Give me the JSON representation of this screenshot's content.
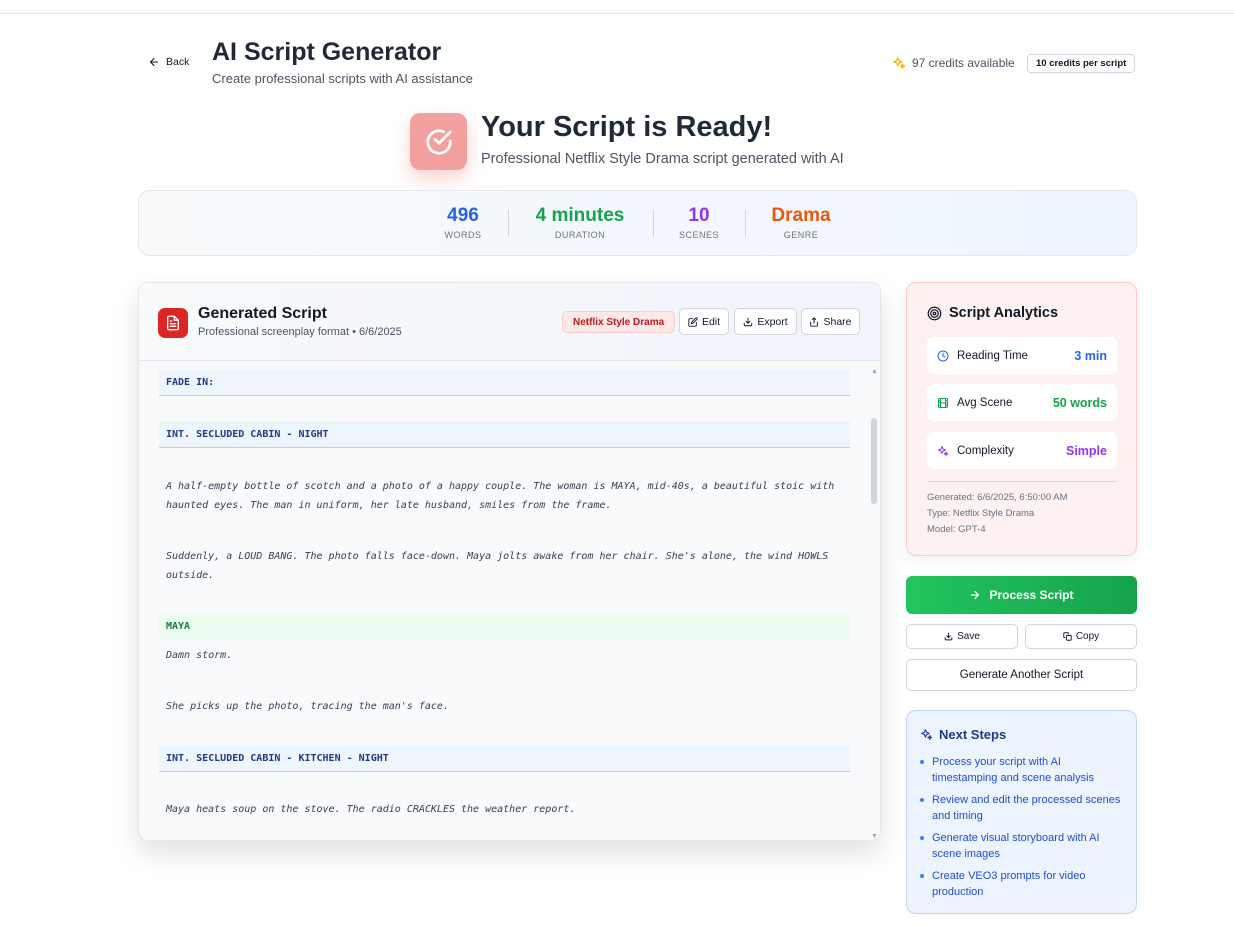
{
  "header": {
    "back_label": "Back",
    "title": "AI Script Generator",
    "subtitle": "Create professional scripts with AI assistance",
    "credits_text": "97 credits available",
    "credit_cost_badge": "10 credits per script"
  },
  "hero": {
    "title": "Your Script is Ready!",
    "subtitle": "Professional Netflix Style Drama script generated with AI"
  },
  "stats": [
    {
      "value": "496",
      "label": "WORDS",
      "color": "#2563eb"
    },
    {
      "value": "4 minutes",
      "label": "DURATION",
      "color": "#16a34a"
    },
    {
      "value": "10",
      "label": "SCENES",
      "color": "#9333ea"
    },
    {
      "value": "Drama",
      "label": "GENRE",
      "color": "#ea580c"
    }
  ],
  "script": {
    "title": "Generated Script",
    "subtitle": "Professional screenplay format • 6/6/2025",
    "genre_badge": "Netflix Style Drama",
    "edit_label": "Edit",
    "export_label": "Export",
    "share_label": "Share",
    "lines": [
      {
        "type": "heading",
        "text": "FADE IN:"
      },
      {
        "type": "heading",
        "text": "INT. SECLUDED CABIN - NIGHT"
      },
      {
        "type": "action",
        "text": "A half-empty bottle of scotch and a photo of a happy couple. The woman is MAYA, mid-40s, a beautiful stoic with haunted eyes. The man in uniform, her late husband, smiles from the frame."
      },
      {
        "type": "action",
        "text": "Suddenly, a LOUD BANG. The photo falls face-down. Maya jolts awake from her chair. She's alone, the wind HOWLS outside."
      },
      {
        "type": "char",
        "text": "MAYA"
      },
      {
        "type": "action",
        "text": "Damn storm."
      },
      {
        "type": "action",
        "text": "She picks up the photo, tracing the man's face."
      },
      {
        "type": "heading",
        "text": "INT. SECLUDED CABIN - KITCHEN - NIGHT"
      },
      {
        "type": "action",
        "text": "Maya heats soup on the stove. The radio CRACKLES the weather report."
      }
    ]
  },
  "analytics": {
    "title": "Script Analytics",
    "rows": [
      {
        "label": "Reading Time",
        "value": "3 min",
        "color": "#2563eb",
        "icon": "clock-icon"
      },
      {
        "label": "Avg Scene",
        "value": "50 words",
        "color": "#16a34a",
        "icon": "film-icon"
      },
      {
        "label": "Complexity",
        "value": "Simple",
        "color": "#9333ea",
        "icon": "sparkles-icon"
      }
    ],
    "generated": "Generated: 6/6/2025, 6:50:00 AM",
    "type": "Type: Netflix Style Drama",
    "model": "Model: GPT-4"
  },
  "actions": {
    "process_label": "Process Script",
    "save_label": "Save",
    "copy_label": "Copy",
    "generate_label": "Generate Another Script"
  },
  "next_steps": {
    "title": "Next Steps",
    "items": [
      "Process your script with AI timestamping and scene analysis",
      "Review and edit the processed scenes and timing",
      "Generate visual storyboard with AI scene images",
      "Create VEO3 prompts for video production"
    ]
  }
}
